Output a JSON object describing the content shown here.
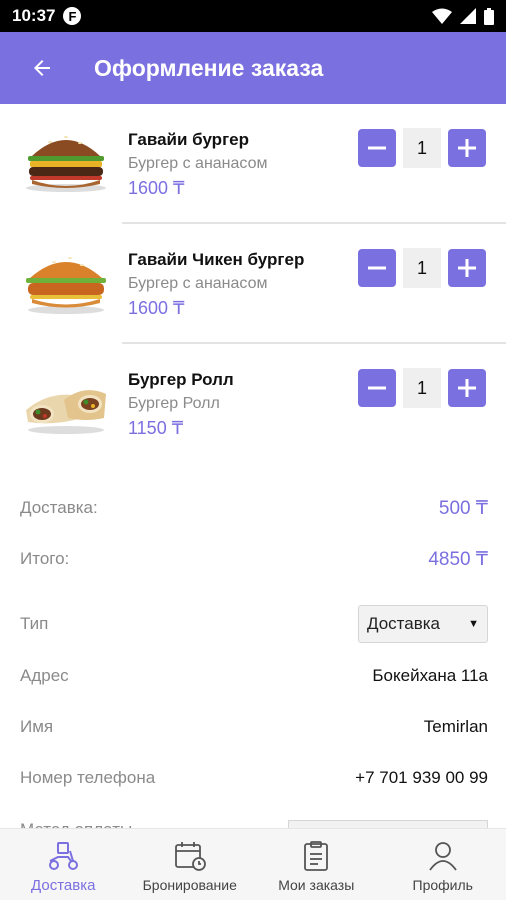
{
  "status_bar": {
    "time": "10:37",
    "app_badge": "F"
  },
  "app_bar": {
    "title": "Оформление заказа",
    "back_icon": "arrow-left-icon"
  },
  "cart_items": [
    {
      "name": "Гавайи бургер",
      "description": "Бургер с ананасом",
      "price": "1600 ₸",
      "quantity": "1",
      "image": "burger"
    },
    {
      "name": "Гавайи Чикен бургер",
      "description": "Бургер с ананасом",
      "price": "1600 ₸",
      "quantity": "1",
      "image": "chicken-burger"
    },
    {
      "name": "Бургер Ролл",
      "description": "Бургер Ролл",
      "price": "1150 ₸",
      "quantity": "1",
      "image": "wrap"
    }
  ],
  "summary": {
    "delivery_label": "Доставка:",
    "delivery_value": "500 ₸",
    "total_label": "Итого:",
    "total_value": "4850 ₸"
  },
  "form": {
    "type_label": "Тип",
    "type_selected": "Доставка",
    "address_label": "Адрес",
    "address_value": "Бокейхана 11а",
    "name_label": "Имя",
    "name_value": "Temirlan",
    "phone_label": "Номер телефона",
    "phone_value": "+7 701 939 00 99",
    "payment_label": "Метод оплаты"
  },
  "bottom_nav": [
    {
      "label": "Доставка",
      "icon": "delivery-scooter-icon",
      "active": true
    },
    {
      "label": "Бронирование",
      "icon": "calendar-clock-icon",
      "active": false
    },
    {
      "label": "Мои заказы",
      "icon": "clipboard-list-icon",
      "active": false
    },
    {
      "label": "Профиль",
      "icon": "user-icon",
      "active": false
    }
  ],
  "colors": {
    "accent": "#7b70e0",
    "muted": "#8a8a8a"
  }
}
